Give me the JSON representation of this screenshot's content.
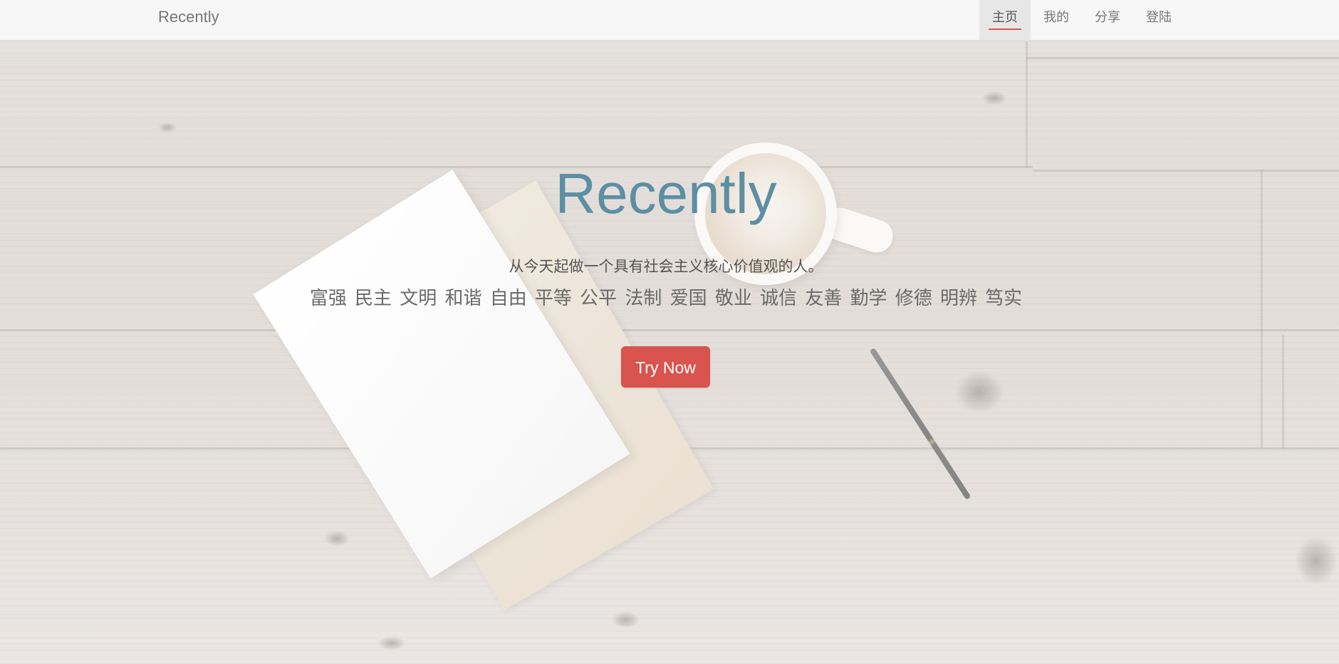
{
  "navbar": {
    "brand": "Recently",
    "items": [
      {
        "label": "主页",
        "active": true
      },
      {
        "label": "我的",
        "active": false
      },
      {
        "label": "分享",
        "active": false
      },
      {
        "label": "登陆",
        "active": false
      }
    ]
  },
  "hero": {
    "title": "Recently",
    "tagline": "从今天起做一个具有社会主义核心价值观的人。",
    "values": "富强 民主 文明 和谐 自由 平等 公平 法制 爱国 敬业 诚信 友善 勤学 修德 明辨 笃实",
    "cta_label": "Try Now"
  },
  "colors": {
    "accent": "#d9534f",
    "title": "#5d8fa3",
    "nav_text": "#777777"
  }
}
